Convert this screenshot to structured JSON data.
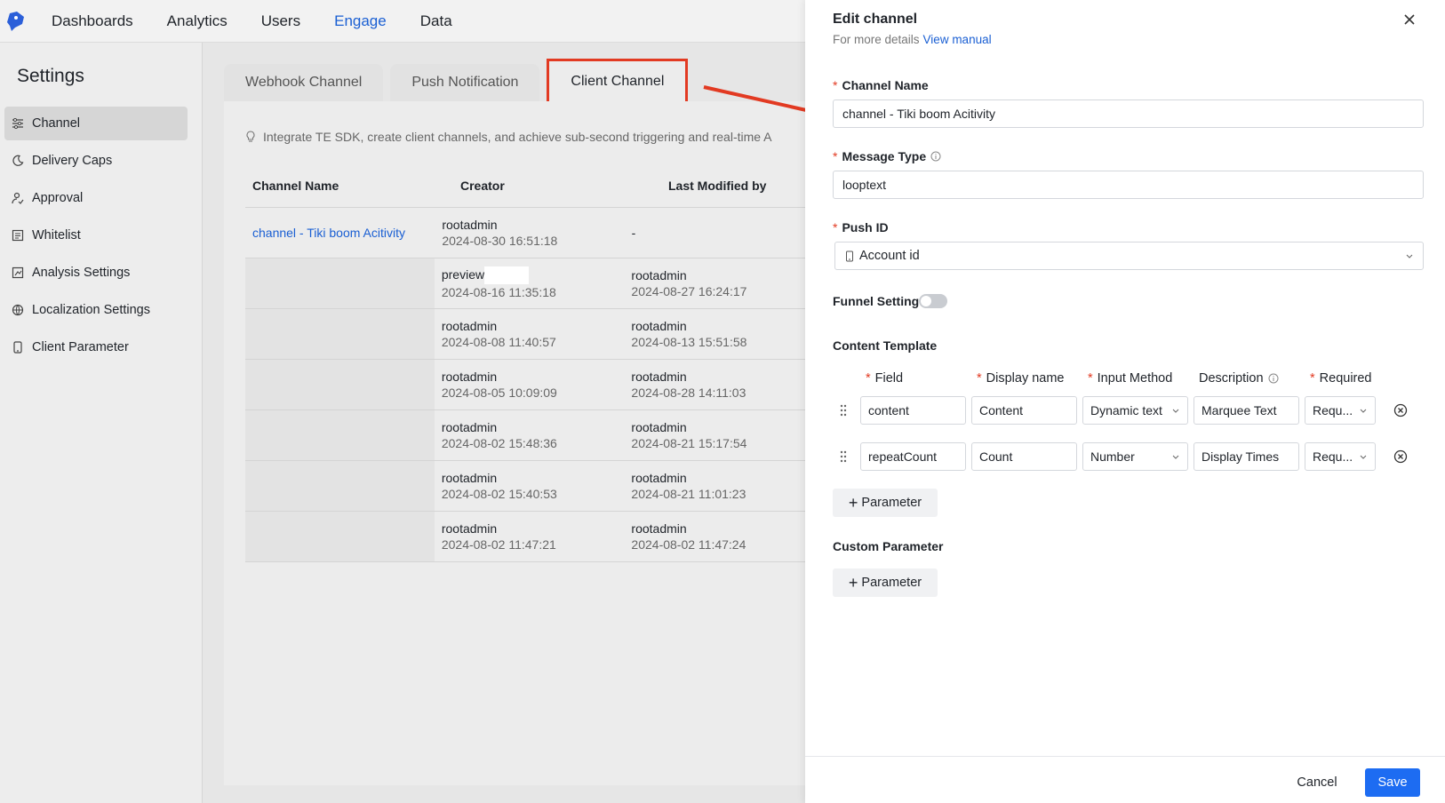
{
  "nav": {
    "items": [
      "Dashboards",
      "Analytics",
      "Users",
      "Engage",
      "Data"
    ],
    "active": "Engage"
  },
  "sidebar": {
    "title": "Settings",
    "items": [
      {
        "label": "Channel",
        "icon": "sliders-icon",
        "active": true
      },
      {
        "label": "Delivery Caps",
        "icon": "moon-icon"
      },
      {
        "label": "Approval",
        "icon": "user-check-icon"
      },
      {
        "label": "Whitelist",
        "icon": "list-icon"
      },
      {
        "label": "Analysis Settings",
        "icon": "chart-settings-icon"
      },
      {
        "label": "Localization Settings",
        "icon": "globe-icon"
      },
      {
        "label": "Client Parameter",
        "icon": "phone-icon"
      }
    ]
  },
  "tabs": [
    "Webhook Channel",
    "Push Notification",
    "Client Channel"
  ],
  "intro": "Integrate TE SDK, create client channels, and achieve sub-second triggering and real-time A",
  "table": {
    "headers": [
      "Channel Name",
      "Creator",
      "Last Modified by"
    ],
    "rows": [
      {
        "name": "channel - Tiki boom Acitivity",
        "creator": "rootadmin",
        "created": "2024-08-30 16:51:18",
        "modifier": "-",
        "modified": ""
      },
      {
        "name": "",
        "creator": "preview",
        "created": "2024-08-16 11:35:18",
        "modifier": "rootadmin",
        "modified": "2024-08-27 16:24:17"
      },
      {
        "name": "",
        "creator": "rootadmin",
        "created": "2024-08-08 11:40:57",
        "modifier": "rootadmin",
        "modified": "2024-08-13 15:51:58"
      },
      {
        "name": "",
        "creator": "rootadmin",
        "created": "2024-08-05 10:09:09",
        "modifier": "rootadmin",
        "modified": "2024-08-28 14:11:03"
      },
      {
        "name": "",
        "creator": "rootadmin",
        "created": "2024-08-02 15:48:36",
        "modifier": "rootadmin",
        "modified": "2024-08-21 15:17:54"
      },
      {
        "name": "",
        "creator": "rootadmin",
        "created": "2024-08-02 15:40:53",
        "modifier": "rootadmin",
        "modified": "2024-08-21 11:01:23"
      },
      {
        "name": "",
        "creator": "rootadmin",
        "created": "2024-08-02 11:47:21",
        "modifier": "rootadmin",
        "modified": "2024-08-02 11:47:24"
      }
    ]
  },
  "drawer": {
    "title": "Edit channel",
    "subtitle": "For more details",
    "manual_link": "View manual",
    "channel_name_label": "Channel Name",
    "channel_name_value": "channel - Tiki boom Acitivity",
    "message_type_label": "Message Type",
    "message_type_value": "looptext",
    "push_id_label": "Push ID",
    "push_id_value": "Account id",
    "funnel_label": "Funnel Setting",
    "funnel_on": false,
    "content_template_label": "Content Template",
    "template_headers": {
      "field": "Field",
      "display": "Display name",
      "method": "Input Method",
      "description": "Description",
      "required": "Required"
    },
    "template_rows": [
      {
        "field": "content",
        "display": "Content",
        "method": "Dynamic text",
        "description": "Marquee Text",
        "required": "Requ..."
      },
      {
        "field": "repeatCount",
        "display": "Count",
        "method": "Number",
        "description": "Display Times",
        "required": "Requ..."
      }
    ],
    "parameter_label": "Parameter",
    "custom_parameter_label": "Custom Parameter",
    "cancel_label": "Cancel",
    "save_label": "Save"
  },
  "colors": {
    "accent": "#1d6cf2",
    "annotation": "#e23a22"
  }
}
